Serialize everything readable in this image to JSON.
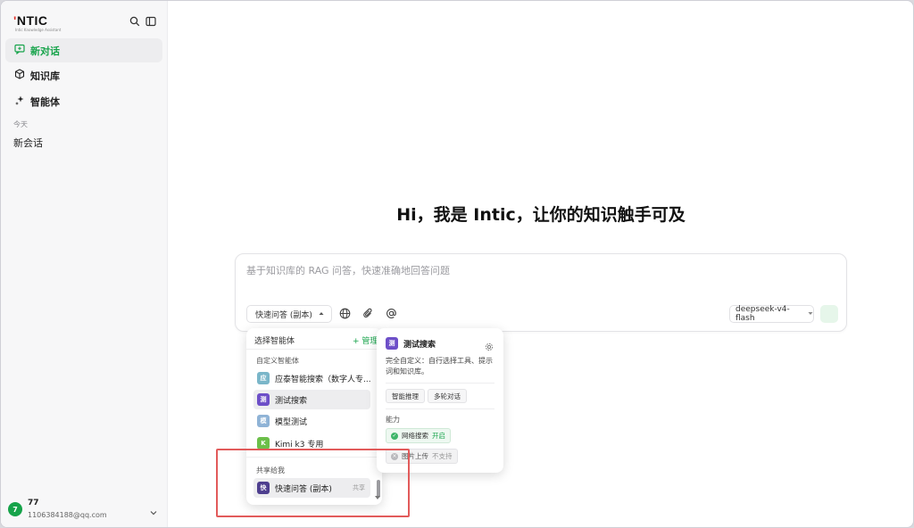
{
  "app": {
    "logo_text": "NTIC",
    "logo_mark": "'",
    "logo_subtitle": "Intic Knowledge Assistant"
  },
  "sidebar": {
    "items": [
      {
        "label": "新对话",
        "icon": "new-chat-icon",
        "active": true
      },
      {
        "label": "知识库",
        "icon": "cube-icon",
        "active": false
      },
      {
        "label": "智能体",
        "icon": "sparkle-icon",
        "active": false
      }
    ],
    "section_label": "今天",
    "conversations": [
      "新会话"
    ],
    "user": {
      "avatar_text": "7",
      "name": "77",
      "email": "1106384188@qq.com"
    }
  },
  "main": {
    "greeting": "Hi，我是 Intic，让你的知识触手可及",
    "composer": {
      "placeholder": "基于知识库的 RAG 问答，快速准确地回答问题",
      "agent_selector_label": "快速问答 (副本)",
      "model_selector_label": "deepseek-v4-flash"
    }
  },
  "agent_panel": {
    "title": "选择智能体",
    "manage_label": "+ 管理",
    "groups": [
      {
        "label": "自定义智能体",
        "agents": [
          {
            "badge": "应",
            "name": "应泰智能搜索（数字人专...",
            "color": "#7ab6c9"
          },
          {
            "badge": "测",
            "name": "测试搜索",
            "color": "#6d4fc8",
            "highlight": true
          },
          {
            "badge": "模",
            "name": "模型测试",
            "color": "#8fb3d6"
          },
          {
            "badge": "K",
            "name": "Kimi k3 专用",
            "color": "#6cbf4a"
          }
        ]
      },
      {
        "label": "共享给我",
        "agents": [
          {
            "badge": "快",
            "name": "快速问答 (副本)",
            "color": "#4e3f8f",
            "tag": "共享",
            "highlight": true
          }
        ]
      }
    ]
  },
  "detail_card": {
    "badge": "测",
    "name": "测试搜索",
    "description": "完全自定义：自行选择工具、提示词和知识库。",
    "tags": [
      "智能推理",
      "多轮对话"
    ],
    "capabilities_label": "能力",
    "capabilities": [
      {
        "name": "网络搜索",
        "status": "开启",
        "enabled": true
      },
      {
        "name": "图片上传",
        "status": "不支持",
        "enabled": false
      }
    ]
  },
  "colors": {
    "accent": "#16a34a",
    "annotation": "#e25b5b",
    "sidebar_bg": "#f7f7f8"
  }
}
